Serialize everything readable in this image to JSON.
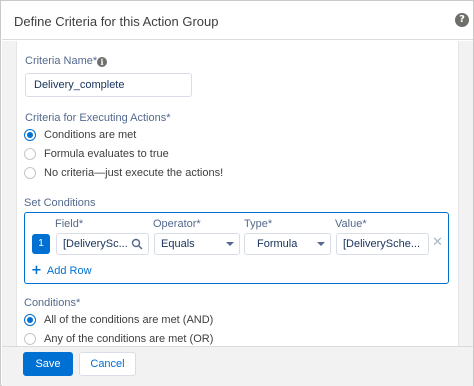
{
  "dialog": {
    "title": "Define Criteria for this Action Group",
    "help_icon": "question-circle-icon"
  },
  "criteria_name": {
    "label": "Criteria Name",
    "required_mark": "*",
    "info_icon": "info-icon",
    "value": "Delivery_complete"
  },
  "executing": {
    "label": "Criteria for Executing Actions",
    "required_mark": "*",
    "options": [
      {
        "label": "Conditions are met",
        "selected": true
      },
      {
        "label": "Formula evaluates to true",
        "selected": false
      },
      {
        "label": "No criteria—just execute the actions!",
        "selected": false
      }
    ]
  },
  "set_conditions": {
    "label": "Set Conditions",
    "columns": {
      "field": "Field",
      "operator": "Operator",
      "type": "Type",
      "value": "Value"
    },
    "required_mark": "*",
    "rows": [
      {
        "number": "1",
        "field": "[DeliverySc...",
        "operator": "Equals",
        "type": "Formula",
        "value": "[DeliverySche..."
      }
    ],
    "add_row_label": "Add Row",
    "remove_icon": "close-icon"
  },
  "conditions": {
    "label": "Conditions",
    "required_mark": "*",
    "options": [
      {
        "label": "All of the conditions are met (AND)",
        "selected": true
      },
      {
        "label": "Any of the conditions are met (OR)",
        "selected": false
      }
    ]
  },
  "footer": {
    "save_label": "Save",
    "cancel_label": "Cancel"
  },
  "colors": {
    "brand": "#0070d2",
    "label": "#54698d",
    "text": "#16325c",
    "background": "#f3f2f2"
  }
}
